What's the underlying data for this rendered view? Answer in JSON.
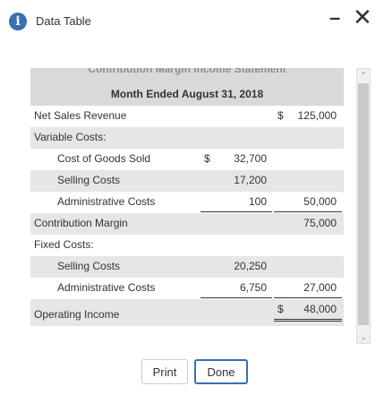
{
  "window": {
    "title": "Data Table",
    "info_icon": "info-icon",
    "minimize_icon": "minimize-icon",
    "close_icon": "close-icon"
  },
  "statement": {
    "heading_cut": "Contribution Margin Income Statement",
    "period": "Month Ended August 31, 2018",
    "rows": {
      "net_sales": {
        "label": "Net Sales Revenue",
        "cur2": "$",
        "col2": "125,000"
      },
      "variable_costs": {
        "label": "Variable Costs:"
      },
      "cogs": {
        "label": "Cost of Goods Sold",
        "cur1": "$",
        "col1": "32,700"
      },
      "var_selling": {
        "label": "Selling Costs",
        "col1": "17,200"
      },
      "var_admin": {
        "label": "Administrative Costs",
        "col1": "100",
        "col2": "50,000"
      },
      "contribution_margin": {
        "label": "Contribution Margin",
        "col2": "75,000"
      },
      "fixed_costs": {
        "label": "Fixed Costs:"
      },
      "fix_selling": {
        "label": "Selling Costs",
        "col1": "20,250"
      },
      "fix_admin": {
        "label": "Administrative Costs",
        "col1": "6,750",
        "col2": "27,000"
      },
      "operating_income": {
        "label": "Operating Income",
        "cur2": "$",
        "col2": "48,000"
      }
    }
  },
  "buttons": {
    "print": "Print",
    "done": "Done"
  },
  "colors": {
    "accent": "#3a6fb0",
    "header_bg": "#d9d9d9",
    "stripe_bg": "#e6e6e6"
  }
}
